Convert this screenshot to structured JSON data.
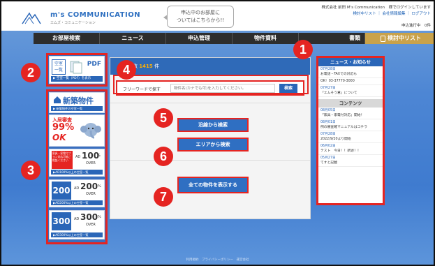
{
  "header": {
    "brand": "m's COMMUNICATION",
    "brand_sub": "エムズ・コミュニケーション",
    "bubble_line1": "申込中のお部屋に",
    "bubble_line2": "ついてはこちらから!!",
    "company_line": "株式会社 前田 M's Communication　様でログインしています",
    "links": "検討中リスト ｜ 会社情報編集 ｜ ログアウト",
    "status": "申込進行中　0件"
  },
  "nav": {
    "items": [
      "お部屋検索",
      "ニュース",
      "申込管理",
      "物件資料",
      "書類"
    ],
    "favorite": "検討中リスト"
  },
  "left": {
    "pdf_box_text": "空室\n一覧",
    "pdf_label": "PDF",
    "pdf_bar": "▶ 空室一覧（PDF）を表示",
    "new_title": "新築物件",
    "new_bar": "▶ 新築物件の空室一覧",
    "pct_text": "入居審査",
    "pct_value": "99%",
    "ok_text": "OK",
    "ad100_side": "家具・家電付プラン対応可能ご相談ください",
    "ad100_label": "AD",
    "ad100_value": "100",
    "ad100_unit": "%",
    "ad100_over": "OVER",
    "ad100_bar": "▶AD100%以上の空室一覧",
    "ad200_big": "200",
    "ad200_label": "AD",
    "ad200_value": "200",
    "ad200_unit": "%",
    "ad200_over": "OVER",
    "ad200_bar": "▶AD200%以上の空室一覧",
    "ad300_big": "300",
    "ad300_label": "AD",
    "ad300_value": "300",
    "ad300_unit": "%",
    "ad300_over": "OVER",
    "ad300_bar": "▶AD300%以上の空室一覧"
  },
  "main": {
    "count_prefix": "数",
    "count_value": "1415",
    "count_suffix": "件",
    "search_label": "フリーワードで探す",
    "search_placeholder": "物件名(カナでも可)を入力してください。",
    "search_button": "検索",
    "route_button": "沿線から検索",
    "area_button": "エリアから検索",
    "all_button": "全ての物件を表示する"
  },
  "right": {
    "news_title": "ニュース・お知らせ",
    "news": [
      {
        "date": "07月28日",
        "text": "お電話・FAXでの対応も"
      },
      {
        "date": "",
        "text": "OK！03-37770-3000"
      },
      {
        "date": "07月27日",
        "text": "「エムそう君」について"
      }
    ],
    "contents_title": "コンテンツ",
    "contents": [
      {
        "date": "08月05日",
        "text": "「家具・家電付対応」開始！"
      },
      {
        "date": "08月01日",
        "text": "例の審査確マニュアルはコチラ"
      },
      {
        "date": "07月28日",
        "text": "2022/9/20より開始"
      },
      {
        "date": "06月02日",
        "text": "テスト　今日！！新述！！"
      },
      {
        "date": "05月27日",
        "text": "てすと記載"
      }
    ]
  },
  "badges": [
    "1",
    "2",
    "3",
    "4",
    "5",
    "6",
    "7"
  ],
  "footer": "利用規約　プライバシーポリシー　運営会社"
}
